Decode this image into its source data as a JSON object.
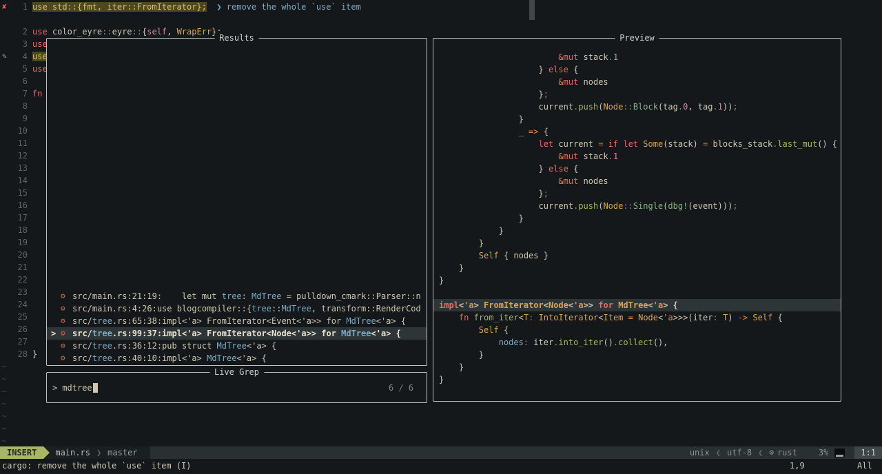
{
  "colors": {
    "bg": "#14181a",
    "fg": "#cfc7b2",
    "fgBright": "#eae3d0",
    "title": "#ccd1ca",
    "border": "#bdc3bf",
    "lineNr": "#5b6466",
    "tilde": "#3d4648",
    "grey": "#928374",
    "red": "#ea6962",
    "orange": "#e78a4e",
    "yellow": "#d8a657",
    "green": "#a9b665",
    "aqua": "#89b482",
    "blue": "#7cabc4",
    "purple": "#d3869b",
    "diagBg": "#4d481f",
    "diagFg": "#d9c35f",
    "selBg": "#2e3537",
    "cursor": "#cfc7b2",
    "counterGrey": "#7d8688",
    "rustIcon": "#c96a4a",
    "scrollbar": "rgba(170,180,182,0.3)",
    "statusBg": "#2a2f31",
    "statusSectionBg": "#1a1f21",
    "statusFg": "#8b9496",
    "fileFg": "#b7bfba",
    "branchFg": "#97a09b",
    "sepFg": "#5f696b",
    "modeBg": "#a9b665",
    "modeFg": "#22271f",
    "locationBg": "#3e4648",
    "locationFg": "#c9d1cb",
    "pbarBg": "#0a0c0d",
    "pbarFill": "#98a29e"
  },
  "buffer": {
    "tilde_char": "~",
    "signs": {
      "error": {
        "glyph": "✘",
        "color": "#ea6962",
        "name": "diagnostic-error-sign-icon"
      },
      "action": {
        "glyph": "✎",
        "color": "#7cabc4",
        "name": "code-action-sign-icon"
      }
    },
    "rows": [
      {
        "n": "1",
        "sign": "error",
        "seg": [
          [
            "diag",
            "use std::{fmt, iter::FromIterator};"
          ],
          [
            "fg",
            "  "
          ],
          [
            "blue",
            "❯ remove the whole `use` item"
          ]
        ]
      },
      {
        "n": ""
      },
      {
        "n": "2",
        "seg": [
          [
            "red",
            "use"
          ],
          [
            "fg",
            " color_eyre"
          ],
          [
            "grey",
            "::"
          ],
          [
            "fg",
            "eyre"
          ],
          [
            "grey",
            "::"
          ],
          [
            "fg",
            "{"
          ],
          [
            "purple",
            "self"
          ],
          [
            "fg",
            ", "
          ],
          [
            "yellow",
            "WrapErr"
          ],
          [
            "fg",
            "};"
          ]
        ]
      },
      {
        "n": "3",
        "seg": [
          [
            "red",
            "use"
          ]
        ]
      },
      {
        "n": "4",
        "sign": "action",
        "seg": [
          [
            "diag",
            "use"
          ]
        ]
      },
      {
        "n": "5",
        "seg": [
          [
            "red",
            "use"
          ]
        ]
      },
      {
        "n": "6"
      },
      {
        "n": "7",
        "seg": [
          [
            "red",
            "fn"
          ]
        ]
      },
      {
        "n": "8"
      },
      {
        "n": "9"
      },
      {
        "n": "10"
      },
      {
        "n": "11"
      },
      {
        "n": "12"
      },
      {
        "n": "13"
      },
      {
        "n": "14"
      },
      {
        "n": "15"
      },
      {
        "n": "16"
      },
      {
        "n": "17"
      },
      {
        "n": "18"
      },
      {
        "n": "19"
      },
      {
        "n": "20"
      },
      {
        "n": "21"
      },
      {
        "n": "22"
      },
      {
        "n": "23"
      },
      {
        "n": "24"
      },
      {
        "n": "25"
      },
      {
        "n": "26"
      },
      {
        "n": "27"
      },
      {
        "n": "28",
        "seg": [
          [
            "fg",
            "}"
          ]
        ]
      },
      {
        "tilde": true
      },
      {
        "tilde": true
      },
      {
        "tilde": true
      },
      {
        "tilde": true
      },
      {
        "tilde": true
      },
      {
        "tilde": true
      },
      {
        "tilde": true
      }
    ]
  },
  "results": {
    "title": "Results",
    "selection_caret": ">",
    "file_icon": {
      "glyph": "⚙",
      "name": "rust-file-icon"
    },
    "rows": [
      {
        "seg": [
          [
            "fg",
            "src/main.rs:21:19:    let mut "
          ],
          [
            "blue",
            "tree"
          ],
          [
            "fg",
            ": "
          ],
          [
            "blue",
            "MdTree"
          ],
          [
            "fg",
            " = pulldown_cmark::Parser::n"
          ]
        ]
      },
      {
        "seg": [
          [
            "fg",
            "src/main.rs:4:26:use blogcompiler::{"
          ],
          [
            "blue",
            "tree"
          ],
          [
            "fg",
            "::"
          ],
          [
            "blue",
            "MdTree"
          ],
          [
            "fg",
            ", transform::RenderCod"
          ]
        ]
      },
      {
        "seg": [
          [
            "fg",
            "src/"
          ],
          [
            "blue",
            "tree"
          ],
          [
            "fg",
            ".rs:65:38:impl<'a> FromIterator<Event<'a>> for "
          ],
          [
            "blue",
            "MdTree"
          ],
          [
            "fg",
            "<'a> {"
          ]
        ]
      },
      {
        "selected": true,
        "seg": [
          [
            "fg",
            "src/"
          ],
          [
            "blue",
            "tree"
          ],
          [
            "fg",
            ".rs:99:37:impl<'a> FromIterator<Node<'a>> for "
          ],
          [
            "blue",
            "MdTree"
          ],
          [
            "fg",
            "<'a> {"
          ]
        ]
      },
      {
        "seg": [
          [
            "fg",
            "src/"
          ],
          [
            "blue",
            "tree"
          ],
          [
            "fg",
            ".rs:36:12:pub struct "
          ],
          [
            "blue",
            "MdTree"
          ],
          [
            "fg",
            "<'a> {"
          ]
        ]
      },
      {
        "seg": [
          [
            "fg",
            "src/"
          ],
          [
            "blue",
            "tree"
          ],
          [
            "fg",
            ".rs:40:10:impl<'a> "
          ],
          [
            "blue",
            "MdTree"
          ],
          [
            "fg",
            "<'a> {"
          ]
        ]
      }
    ]
  },
  "prompt": {
    "title": "Live Grep",
    "caret": ">",
    "query": "mdtree",
    "counter": "6 / 6"
  },
  "preview": {
    "title": "Preview",
    "rows": [
      {
        "ind": 24,
        "seg": [
          [
            "orange",
            "&"
          ],
          [
            "red",
            "mut"
          ],
          [
            "fg",
            " stack"
          ],
          [
            "grey",
            "."
          ],
          [
            "purple",
            "1"
          ]
        ]
      },
      {
        "ind": 20,
        "seg": [
          [
            "fg",
            "} "
          ],
          [
            "red",
            "else"
          ],
          [
            "fg",
            " {"
          ]
        ]
      },
      {
        "ind": 24,
        "seg": [
          [
            "orange",
            "&"
          ],
          [
            "red",
            "mut"
          ],
          [
            "fg",
            " nodes"
          ]
        ]
      },
      {
        "ind": 20,
        "seg": [
          [
            "fg",
            "}"
          ],
          [
            "grey",
            ";"
          ]
        ]
      },
      {
        "ind": 20,
        "seg": [
          [
            "fg",
            "current"
          ],
          [
            "grey",
            "."
          ],
          [
            "green",
            "push"
          ],
          [
            "fg",
            "("
          ],
          [
            "yellow",
            "Node"
          ],
          [
            "grey",
            "::"
          ],
          [
            "aqua",
            "Block"
          ],
          [
            "fg",
            "(tag"
          ],
          [
            "grey",
            "."
          ],
          [
            "purple",
            "0"
          ],
          [
            "fg",
            ", tag"
          ],
          [
            "grey",
            "."
          ],
          [
            "purple",
            "1"
          ],
          [
            "fg",
            "))"
          ],
          [
            "grey",
            ";"
          ]
        ]
      },
      {
        "ind": 16,
        "seg": [
          [
            "fg",
            "}"
          ]
        ]
      },
      {
        "ind": 16,
        "seg": [
          [
            "fg",
            "_"
          ],
          [
            "orange",
            " => "
          ],
          [
            "fg",
            "{"
          ]
        ]
      },
      {
        "ind": 20,
        "seg": [
          [
            "red",
            "let"
          ],
          [
            "fg",
            " current "
          ],
          [
            "orange",
            "="
          ],
          [
            "fg",
            " "
          ],
          [
            "red",
            "if"
          ],
          [
            "fg",
            " "
          ],
          [
            "red",
            "let"
          ],
          [
            "fg",
            " "
          ],
          [
            "yellow",
            "Some"
          ],
          [
            "fg",
            "(stack) "
          ],
          [
            "orange",
            "="
          ],
          [
            "fg",
            " blocks_stack"
          ],
          [
            "grey",
            "."
          ],
          [
            "green",
            "last_mut"
          ],
          [
            "fg",
            "() {"
          ]
        ]
      },
      {
        "ind": 24,
        "seg": [
          [
            "orange",
            "&"
          ],
          [
            "red",
            "mut"
          ],
          [
            "fg",
            " stack"
          ],
          [
            "grey",
            "."
          ],
          [
            "purple",
            "1"
          ]
        ]
      },
      {
        "ind": 20,
        "seg": [
          [
            "fg",
            "} "
          ],
          [
            "red",
            "else"
          ],
          [
            "fg",
            " {"
          ]
        ]
      },
      {
        "ind": 24,
        "seg": [
          [
            "orange",
            "&"
          ],
          [
            "red",
            "mut"
          ],
          [
            "fg",
            " nodes"
          ]
        ]
      },
      {
        "ind": 20,
        "seg": [
          [
            "fg",
            "}"
          ],
          [
            "grey",
            ";"
          ]
        ]
      },
      {
        "ind": 20,
        "seg": [
          [
            "fg",
            "current"
          ],
          [
            "grey",
            "."
          ],
          [
            "green",
            "push"
          ],
          [
            "fg",
            "("
          ],
          [
            "yellow",
            "Node"
          ],
          [
            "grey",
            "::"
          ],
          [
            "aqua",
            "Single"
          ],
          [
            "fg",
            "("
          ],
          [
            "aqua",
            "dbg!"
          ],
          [
            "fg",
            "(event)))"
          ],
          [
            "grey",
            ";"
          ]
        ]
      },
      {
        "ind": 16,
        "seg": [
          [
            "fg",
            "}"
          ]
        ]
      },
      {
        "ind": 12,
        "seg": [
          [
            "fg",
            "}"
          ]
        ]
      },
      {
        "ind": 8,
        "seg": [
          [
            "fg",
            "}"
          ]
        ]
      },
      {
        "ind": 8,
        "seg": [
          [
            "yellow",
            "Self"
          ],
          [
            "fg",
            " { nodes }"
          ]
        ]
      },
      {
        "ind": 4,
        "seg": [
          [
            "fg",
            "}"
          ]
        ]
      },
      {
        "ind": 0,
        "seg": [
          [
            "fg",
            "}"
          ]
        ]
      },
      {
        "blank": true
      },
      {
        "hl": true,
        "ind": 0,
        "seg": [
          [
            "red",
            "impl"
          ],
          [
            "fg",
            "<"
          ],
          [
            "orange",
            "'a"
          ],
          [
            "fg",
            "> "
          ],
          [
            "yellow",
            "FromIterator"
          ],
          [
            "fg",
            "<"
          ],
          [
            "yellow",
            "Node"
          ],
          [
            "fg",
            "<"
          ],
          [
            "orange",
            "'a"
          ],
          [
            "fg",
            ">> "
          ],
          [
            "red",
            "for"
          ],
          [
            "fg",
            " "
          ],
          [
            "yellow",
            "MdTree"
          ],
          [
            "fg",
            "<"
          ],
          [
            "orange",
            "'a"
          ],
          [
            "fg",
            "> {"
          ]
        ]
      },
      {
        "ind": 4,
        "seg": [
          [
            "red",
            "fn"
          ],
          [
            "fg",
            " "
          ],
          [
            "green",
            "from_iter"
          ],
          [
            "fg",
            "<"
          ],
          [
            "yellow",
            "T"
          ],
          [
            "grey",
            ":"
          ],
          [
            "fg",
            " "
          ],
          [
            "yellow",
            "IntoIterator"
          ],
          [
            "fg",
            "<"
          ],
          [
            "yellow",
            "Item"
          ],
          [
            "fg",
            " "
          ],
          [
            "orange",
            "="
          ],
          [
            "fg",
            " "
          ],
          [
            "yellow",
            "Node"
          ],
          [
            "fg",
            "<"
          ],
          [
            "orange",
            "'a"
          ],
          [
            "fg",
            ">>>(iter"
          ],
          [
            "grey",
            ":"
          ],
          [
            "fg",
            " "
          ],
          [
            "yellow",
            "T"
          ],
          [
            "fg",
            ") "
          ],
          [
            "orange",
            "->"
          ],
          [
            "fg",
            " "
          ],
          [
            "yellow",
            "Self"
          ],
          [
            "fg",
            " {"
          ]
        ]
      },
      {
        "ind": 8,
        "seg": [
          [
            "yellow",
            "Self"
          ],
          [
            "fg",
            " {"
          ]
        ]
      },
      {
        "ind": 12,
        "seg": [
          [
            "blue",
            "nodes"
          ],
          [
            "grey",
            ":"
          ],
          [
            "fg",
            " iter"
          ],
          [
            "grey",
            "."
          ],
          [
            "green",
            "into_iter"
          ],
          [
            "fg",
            "()"
          ],
          [
            "grey",
            "."
          ],
          [
            "green",
            "collect"
          ],
          [
            "fg",
            "(),"
          ]
        ]
      },
      {
        "ind": 8,
        "seg": [
          [
            "fg",
            "}"
          ]
        ]
      },
      {
        "ind": 4,
        "seg": [
          [
            "fg",
            "}"
          ]
        ]
      },
      {
        "ind": 0,
        "seg": [
          [
            "fg",
            "}"
          ]
        ]
      }
    ]
  },
  "statusline": {
    "mode": "INSERT",
    "filename": "main.rs",
    "chevron": "❯",
    "branch": "master",
    "fileformat": "unix",
    "rsep": "❮",
    "encoding": "utf-8",
    "filetype_icon": "⚙",
    "filetype": "rust",
    "progress": "3%",
    "location": "1:1"
  },
  "cmdline": {
    "message": "cargo: remove the whole `use` item (I)",
    "ruler": "1,9",
    "scroll": "All"
  }
}
